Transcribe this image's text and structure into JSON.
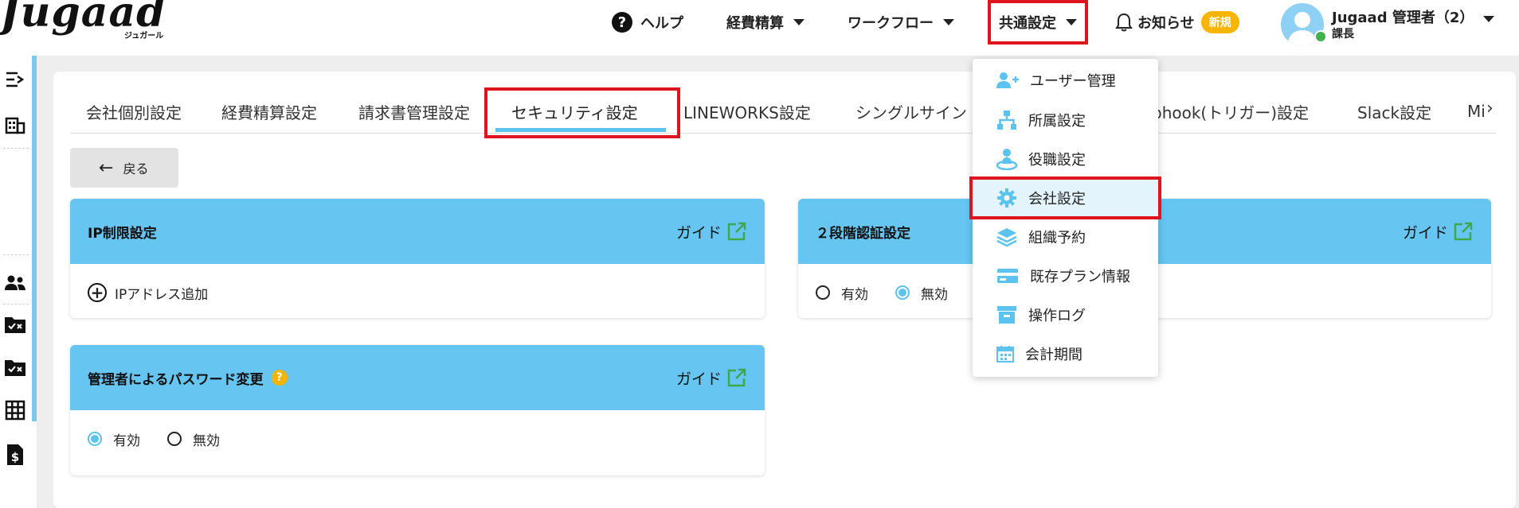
{
  "logo": {
    "main": "Jugaad",
    "sub": "ジュガール"
  },
  "header": {
    "help": "ヘルプ",
    "expense": "経費精算",
    "workflow": "ワークフロー",
    "common_settings": "共通設定",
    "notice": "お知らせ",
    "new_badge": "新規",
    "user_name": "Jugaad 管理者（2）",
    "user_role": "課長"
  },
  "dropdown": {
    "items": [
      {
        "label": "ユーザー管理",
        "icon": "user-add-icon"
      },
      {
        "label": "所属設定",
        "icon": "org-tree-icon"
      },
      {
        "label": "役職設定",
        "icon": "position-icon"
      },
      {
        "label": "会社設定",
        "icon": "gear-icon"
      },
      {
        "label": "組織予約",
        "icon": "layers-icon"
      },
      {
        "label": "既存プラン情報",
        "icon": "card-icon"
      },
      {
        "label": "操作ログ",
        "icon": "archive-icon"
      },
      {
        "label": "会計期間",
        "icon": "calendar-icon"
      }
    ]
  },
  "tabs": [
    "会社個別設定",
    "経費精算設定",
    "請求書管理設定",
    "セキュリティ設定",
    "LINEWORKS設定",
    "シングルサイン",
    "bhook(トリガー)設定",
    "Slack設定",
    "Mi"
  ],
  "back_label": "戻る",
  "cards": {
    "ip": {
      "title": "IP制限設定",
      "guide": "ガイド",
      "add_label": "IPアドレス追加"
    },
    "two_factor": {
      "title": "２段階認証設定",
      "guide": "ガイド",
      "opt_on": "有効",
      "opt_off": "無効",
      "selected": "無効"
    },
    "password": {
      "title": "管理者によるパスワード変更",
      "guide": "ガイド",
      "help": "?",
      "opt_on": "有効",
      "opt_off": "無効",
      "selected": "有効"
    }
  },
  "colors": {
    "accent": "#66c5f1",
    "highlight": "#e0141e",
    "badge": "#f7b500"
  }
}
